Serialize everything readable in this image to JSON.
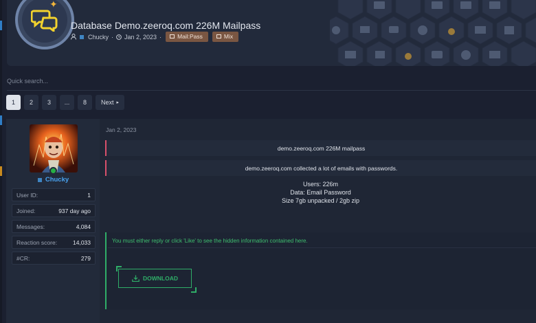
{
  "thread": {
    "title": "Database Demo.zeeroq.com 226M Mailpass",
    "author": "Chucky",
    "date": "Jan 2, 2023",
    "separator": "·",
    "tags": [
      "Mail:Pass",
      "Mix"
    ]
  },
  "search": {
    "placeholder": "Quick search..."
  },
  "pagination": {
    "pages": [
      "1",
      "2",
      "3",
      "...",
      "8"
    ],
    "active": "1",
    "next_label": "Next"
  },
  "post": {
    "date": "Jan 2, 2023",
    "user": {
      "name": "Chucky",
      "stats": [
        {
          "label": "User ID:",
          "value": "1"
        },
        {
          "label": "Joined:",
          "value": "937 day ago"
        },
        {
          "label": "Messages:",
          "value": "4,084"
        },
        {
          "label": "Reaction score:",
          "value": "14,033"
        },
        {
          "label": "#CR:",
          "value": "279"
        }
      ]
    },
    "lines": [
      "demo.zeeroq.com 226M mailpass",
      "demo.zeeroq.com collected a lot of emails with passwords."
    ],
    "body": [
      "Users: 226m",
      "Data: Email Password",
      "Size 7gb unpacked / 2gb zip"
    ],
    "hidden_message": "You must either reply or click 'Like' to see the hidden information contained here.",
    "download_label": "DOWNLOAD"
  },
  "colors": {
    "accent_green": "#2fae68",
    "accent_pink": "#d9506b",
    "username_blue": "#49a3f0",
    "tag_brown": "#7a5642"
  },
  "icons": [
    "chat-bubbles-icon",
    "star-icon",
    "user-icon",
    "clock-icon",
    "tag-icon",
    "caret-right-icon",
    "download-icon",
    "online-status-icon",
    "cart-icon",
    "medal-icon",
    "newspaper-icon",
    "group-icon",
    "calendar-icon",
    "film-icon"
  ]
}
